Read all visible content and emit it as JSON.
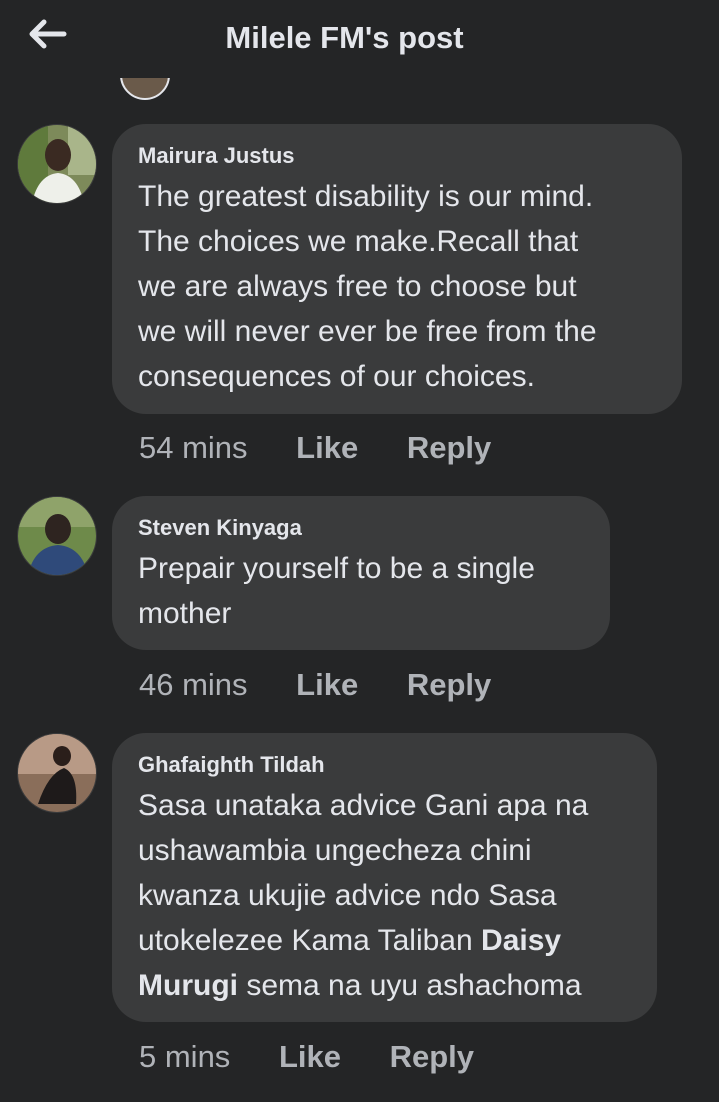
{
  "header": {
    "title": "Milele FM's post",
    "back_icon": "arrow-left-icon"
  },
  "colors": {
    "background": "#242526",
    "bubble": "#3a3b3c",
    "text": "#e4e6eb",
    "muted": "#b0b3b8"
  },
  "comments": [
    {
      "name": "Mairura Justus",
      "lines": [
        "The greatest disability is our mind.",
        "The choices we make.Recall that",
        "we are always free to choose but",
        "we will never ever be free from the",
        "consequences of our choices."
      ],
      "time": "54 mins",
      "like": "Like",
      "reply": "Reply"
    },
    {
      "name": "Steven Kinyaga",
      "lines": [
        "Prepair yourself to be a single",
        "mother"
      ],
      "time": "46 mins",
      "like": "Like",
      "reply": "Reply"
    },
    {
      "name": "Ghafaighth Tildah",
      "lines": [
        "Sasa unataka advice Gani apa na",
        "ushawambia ungecheza chini",
        "kwanza ukujie advice ndo Sasa"
      ],
      "line4_pre": "utokelezee Kama Taliban",
      "mention_first": "Daisy",
      "mention_last": "Murugi",
      "line5_post": "sema na uyu ashachoma",
      "time": "5 mins",
      "like": "Like",
      "reply": "Reply"
    }
  ]
}
